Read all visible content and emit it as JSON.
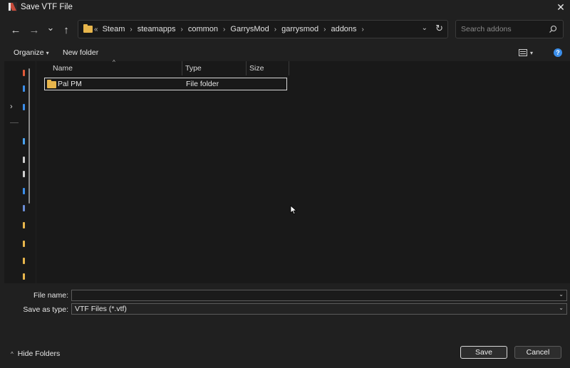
{
  "window": {
    "title": "Save VTF File",
    "close_glyph": "✕"
  },
  "nav": {
    "back_glyph": "←",
    "forward_glyph": "→",
    "recent_glyph": "⌄",
    "up_glyph": "↑"
  },
  "address": {
    "overflow": "«",
    "crumbs": [
      "Steam",
      "steamapps",
      "common",
      "GarrysMod",
      "garrysmod",
      "addons"
    ],
    "separator": "›",
    "dropdown_glyph": "⌄",
    "refresh_glyph": "↻"
  },
  "search": {
    "placeholder": "Search addons"
  },
  "toolbar": {
    "organize": "Organize",
    "organize_caret": "▾",
    "new_folder": "New folder",
    "view_caret": "▾",
    "help": "?"
  },
  "nav_pane": {
    "expand_glyph": "›",
    "icons": [
      {
        "name": "home-icon",
        "color": "#e05a3a"
      },
      {
        "name": "gallery-icon",
        "color": "#3b8eea"
      },
      {
        "name": "onedrive-icon",
        "color": "#3b8eea"
      },
      {
        "name": "desktop-icon",
        "color": "#4aa3f0"
      },
      {
        "name": "downloads-icon",
        "color": "#cfcfcf"
      },
      {
        "name": "documents-icon",
        "color": "#cfcfcf"
      },
      {
        "name": "pictures-icon",
        "color": "#3b8eea"
      },
      {
        "name": "music-icon",
        "color": "#6b8dd6"
      },
      {
        "name": "folder-icon",
        "color": "#e8b64c"
      },
      {
        "name": "folder-icon",
        "color": "#e8b64c"
      },
      {
        "name": "folder-icon",
        "color": "#e8b64c"
      },
      {
        "name": "folder-icon",
        "color": "#e8b64c"
      }
    ]
  },
  "file_list": {
    "columns": {
      "name": "Name",
      "type": "Type",
      "size": "Size"
    },
    "sort_glyph": "^",
    "rows": [
      {
        "name": "Pal PM",
        "type": "File folder",
        "size": ""
      }
    ]
  },
  "form": {
    "file_name_label": "File name:",
    "file_name_value": "",
    "save_as_type_label": "Save as type:",
    "save_as_type_value": "VTF Files (*.vtf)",
    "chevron": "⌄"
  },
  "footer": {
    "hide_folders_glyph": "^",
    "hide_folders": "Hide Folders",
    "save": "Save",
    "cancel": "Cancel"
  }
}
